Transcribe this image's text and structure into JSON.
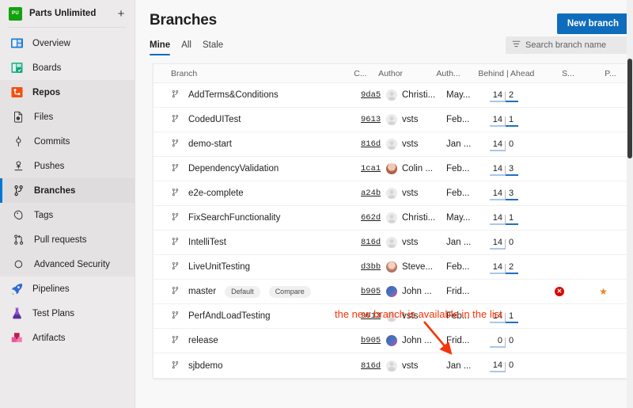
{
  "sidebar": {
    "project": {
      "avatar_initials": "PU",
      "name": "Parts Unlimited",
      "add_label": "+"
    },
    "items": [
      {
        "label": "Overview",
        "icon": "overview-icon"
      },
      {
        "label": "Boards",
        "icon": "boards-icon"
      },
      {
        "label": "Repos",
        "icon": "repos-icon"
      },
      {
        "label": "Files",
        "icon": "files-icon"
      },
      {
        "label": "Commits",
        "icon": "commits-icon"
      },
      {
        "label": "Pushes",
        "icon": "pushes-icon"
      },
      {
        "label": "Branches",
        "icon": "branches-icon"
      },
      {
        "label": "Tags",
        "icon": "tags-icon"
      },
      {
        "label": "Pull requests",
        "icon": "pull-requests-icon"
      },
      {
        "label": "Advanced Security",
        "icon": "advanced-security-icon"
      },
      {
        "label": "Pipelines",
        "icon": "pipelines-icon"
      },
      {
        "label": "Test Plans",
        "icon": "test-plans-icon"
      },
      {
        "label": "Artifacts",
        "icon": "artifacts-icon"
      }
    ]
  },
  "header": {
    "title": "Branches",
    "new_branch_label": "New branch"
  },
  "tabs": [
    {
      "label": "Mine",
      "active": true
    },
    {
      "label": "All",
      "active": false
    },
    {
      "label": "Stale",
      "active": false
    }
  ],
  "search": {
    "placeholder": "Search branch name",
    "value": "",
    "icon": "filter-icon"
  },
  "table": {
    "columns": [
      "Branch",
      "C...",
      "Author",
      "Auth...",
      "Behind | Ahead",
      "S...",
      "P..."
    ],
    "rows": [
      {
        "branch": "AddTerms&Conditions",
        "commit": "9da5",
        "author": "Christi...",
        "avatar": "generic",
        "date": "May...",
        "behind": "14",
        "ahead": "2"
      },
      {
        "branch": "CodedUITest",
        "commit": "9613",
        "author": "vsts",
        "avatar": "generic",
        "date": "Feb...",
        "behind": "14",
        "ahead": "1"
      },
      {
        "branch": "demo-start",
        "commit": "816d",
        "author": "vsts",
        "avatar": "generic",
        "date": "Jan ...",
        "behind": "14",
        "ahead": "0"
      },
      {
        "branch": "DependencyValidation",
        "commit": "1ca1",
        "author": "Colin ...",
        "avatar": "p1",
        "date": "Feb...",
        "behind": "14",
        "ahead": "3"
      },
      {
        "branch": "e2e-complete",
        "commit": "a24b",
        "author": "vsts",
        "avatar": "generic",
        "date": "Feb...",
        "behind": "14",
        "ahead": "3"
      },
      {
        "branch": "FixSearchFunctionality",
        "commit": "662d",
        "author": "Christi...",
        "avatar": "generic",
        "date": "May...",
        "behind": "14",
        "ahead": "1"
      },
      {
        "branch": "IntelliTest",
        "commit": "816d",
        "author": "vsts",
        "avatar": "generic",
        "date": "Jan ...",
        "behind": "14",
        "ahead": "0"
      },
      {
        "branch": "LiveUnitTesting",
        "commit": "d3bb",
        "author": "Steve...",
        "avatar": "p2",
        "date": "Feb...",
        "behind": "14",
        "ahead": "2"
      },
      {
        "branch": "master",
        "commit": "b905",
        "author": "John ...",
        "avatar": "p3",
        "date": "Frid...",
        "behind": "",
        "ahead": "",
        "badges": [
          "Default",
          "Compare"
        ],
        "status_icon": "error-icon",
        "favorite_icon": "star-icon"
      },
      {
        "branch": "PerfAndLoadTesting",
        "commit": "9613",
        "author": "vsts",
        "avatar": "generic",
        "date": "Feb...",
        "behind": "14",
        "ahead": "1"
      },
      {
        "branch": "release",
        "commit": "b905",
        "author": "John ...",
        "avatar": "p3",
        "date": "Frid...",
        "behind": "0",
        "ahead": "0"
      },
      {
        "branch": "sjbdemo",
        "commit": "816d",
        "author": "vsts",
        "avatar": "generic",
        "date": "Jan ...",
        "behind": "14",
        "ahead": "0"
      }
    ]
  },
  "annotation": {
    "text": "the new branch is available in the list",
    "color": "#f4350a"
  }
}
